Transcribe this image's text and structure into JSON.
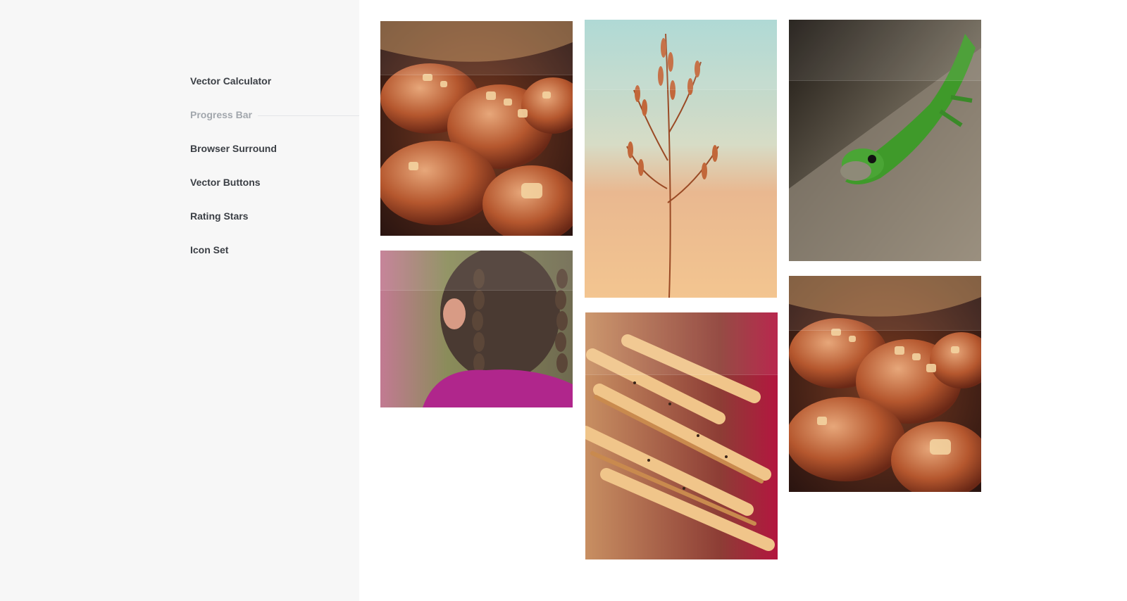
{
  "nav": {
    "items": [
      {
        "label": "Vector Calculator",
        "active": false
      },
      {
        "label": "Progress Bar",
        "active": true
      },
      {
        "label": "Browser Surround",
        "active": false
      },
      {
        "label": "Vector Buttons",
        "active": false
      },
      {
        "label": "Rating Stars",
        "active": false
      },
      {
        "label": "Icon Set",
        "active": false
      }
    ]
  },
  "gallery": {
    "photos": [
      {
        "subject": "pastries-photo"
      },
      {
        "subject": "wheat-grass-photo"
      },
      {
        "subject": "green-lizard-photo"
      },
      {
        "subject": "girl-braids-photo"
      },
      {
        "subject": "baked-fries-photo"
      },
      {
        "subject": "pastries-photo"
      }
    ]
  },
  "colors": {
    "sidebar_bg": "#f7f7f7",
    "nav_text": "#3b3f45",
    "nav_active_text": "#a2a7ad"
  }
}
